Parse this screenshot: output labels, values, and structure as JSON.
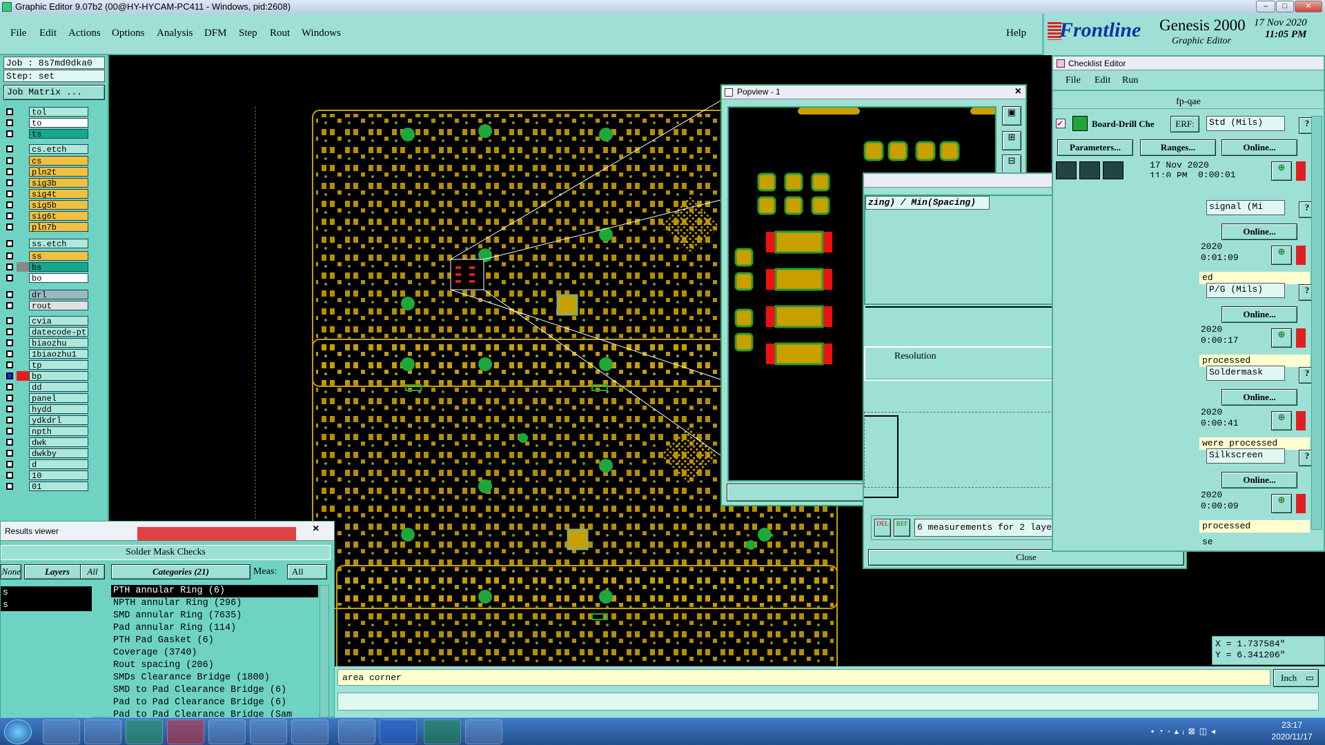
{
  "window": {
    "title": "Graphic Editor 9.07b2 (00@HY-HYCAM-PC411 - Windows, pid:2608)",
    "controls": {
      "minimize": "–",
      "maximize": "□",
      "close": "✕"
    }
  },
  "menubar": {
    "items": [
      "File",
      "Edit",
      "Actions",
      "Options",
      "Analysis",
      "DFM",
      "Step",
      "Rout",
      "Windows"
    ],
    "help": "Help"
  },
  "brand": {
    "logo": "Frontline",
    "product": "Genesis 2000",
    "subtitle": "Graphic Editor",
    "date": "17 Nov 2020",
    "time": "11:05 PM"
  },
  "job_panel": {
    "job": "Job : 8s7md0dka0",
    "step": "Step: set",
    "matrix_button": "Job Matrix ...",
    "layers": [
      {
        "name": "tol",
        "color": "#aee8dc"
      },
      {
        "name": "to",
        "color": "#ffffff"
      },
      {
        "name": "ts",
        "color": "#14a88c"
      },
      {
        "name": "cs.etch",
        "color": "#aee8dc"
      },
      {
        "name": "cs",
        "color": "#f0c040"
      },
      {
        "name": "pln2t",
        "color": "#f0c040"
      },
      {
        "name": "sig3b",
        "color": "#f0c040"
      },
      {
        "name": "sig4t",
        "color": "#f0c040"
      },
      {
        "name": "sig5b",
        "color": "#f0c040"
      },
      {
        "name": "sig6t",
        "color": "#f0c040"
      },
      {
        "name": "pln7b",
        "color": "#f0c040"
      },
      {
        "name": "ss.etch",
        "color": "#aee8dc"
      },
      {
        "name": "ss",
        "color": "#f0c040"
      },
      {
        "name": "bs",
        "color": "#14a88c"
      },
      {
        "name": "bo",
        "color": "#ffffff"
      },
      {
        "name": "drl",
        "color": "#9ab8c0"
      },
      {
        "name": "rout",
        "color": "#e0e0e0"
      },
      {
        "name": "cvia",
        "color": "#aee8dc"
      },
      {
        "name": "datecode-pt",
        "color": "#aee8dc"
      },
      {
        "name": "biaozhu",
        "color": "#aee8dc"
      },
      {
        "name": "1biaozhu1",
        "color": "#aee8dc"
      },
      {
        "name": "tp",
        "color": "#aee8dc"
      },
      {
        "name": "bp",
        "color": "#aee8dc"
      },
      {
        "name": "dd",
        "color": "#aee8dc"
      },
      {
        "name": "panel",
        "color": "#aee8dc"
      },
      {
        "name": "hydd",
        "color": "#aee8dc"
      },
      {
        "name": "ydkdrl",
        "color": "#aee8dc"
      },
      {
        "name": "npth",
        "color": "#aee8dc"
      },
      {
        "name": "dwk",
        "color": "#aee8dc"
      },
      {
        "name": "dwkby",
        "color": "#aee8dc"
      },
      {
        "name": "d",
        "color": "#aee8dc"
      },
      {
        "name": "10",
        "color": "#aee8dc"
      },
      {
        "name": "01",
        "color": "#aee8dc"
      }
    ]
  },
  "popview": {
    "title": "Popview - 1",
    "close_button": "Close"
  },
  "checklist": {
    "title": "Checklist Editor",
    "menu": [
      "File",
      "Edit",
      "Run"
    ],
    "checklist_name": "fp-qae",
    "action_name": "Board-Drill Che",
    "erf_button": "ERF:",
    "erf_value": "Std (Mils)",
    "parameters_button": "Parameters...",
    "ranges_button": "Ranges...",
    "online_button": "Online...",
    "date": "17 Nov 2020",
    "date_partial": "11:0 PM",
    "elapsed": "0:00:01",
    "rows": [
      {
        "erf": "signal (Mi",
        "elapsed": "0:01:09",
        "year": "2020",
        "status": "ed"
      },
      {
        "erf": "P/G (Mils)",
        "elapsed": "0:00:17",
        "year": "2020",
        "status": "processed"
      },
      {
        "erf": "Soldermask",
        "elapsed": "0:00:41",
        "year": "2020",
        "status": "were processed"
      },
      {
        "erf": "Silkscreen",
        "elapsed": "0:00:09",
        "year": "2020",
        "status": "processed"
      }
    ],
    "tail": "se"
  },
  "ranges_window": {
    "header": "zing) / Min(Spacing)",
    "resolution": "Resolution",
    "del_label": "DEL",
    "ref_label": "REF",
    "summary": "6 measurements for 2 layers",
    "close_button": "Close"
  },
  "coords": {
    "x": "X = 1.737584\"",
    "y": "Y = 6.341206\""
  },
  "status": {
    "prompt": "area corner",
    "units": "Inch"
  },
  "results": {
    "title": "Results viewer",
    "heading": "Solder Mask Checks",
    "none_button": "None",
    "layers_button": "Layers",
    "all_button": "All",
    "categories_label": "Categories (21)",
    "meas_label": "Meas:",
    "meas_value": "All",
    "layer_rows": [
      "s",
      "s"
    ],
    "categories": [
      "PTH annular Ring (6)",
      "NPTH annular Ring (296)",
      "SMD annular Ring (7635)",
      "Pad annular Ring (114)",
      "PTH Pad Gasket (6)",
      "Coverage (3740)",
      "Rout spacing (206)",
      "SMDs Clearance Bridge (1800)",
      "SMD to Pad Clearance Bridge (6)",
      "Pad to Pad Clearance Bridge (6)",
      "Pad to Pad Clearance Bridge (Sam"
    ]
  },
  "taskbar": {
    "time": "23:17",
    "date": "2020/11/17"
  }
}
